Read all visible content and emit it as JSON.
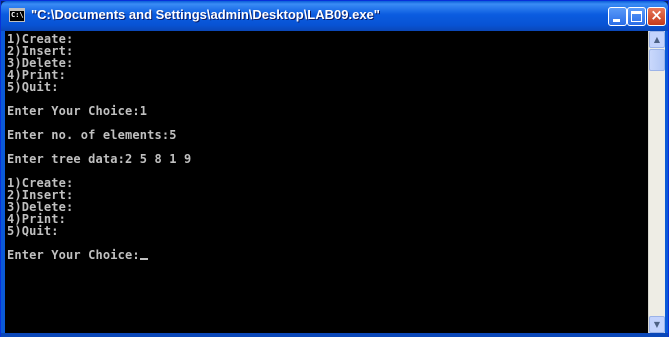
{
  "window": {
    "title": "\"C:\\Documents and Settings\\admin\\Desktop\\LAB09.exe\"",
    "icon_text": "C:\\",
    "accent_color": "#0a5fd8",
    "close_color": "#c43a1a"
  },
  "title_buttons": {
    "minimize_icon": "minimize-icon",
    "maximize_icon": "maximize-icon",
    "close_icon": "close-icon",
    "close_glyph": "×"
  },
  "console": {
    "background": "#000000",
    "foreground": "#c0c0c0",
    "lines": [
      "1)Create:",
      "2)Insert:",
      "3)Delete:",
      "4)Print:",
      "5)Quit:",
      "",
      "Enter Your Choice:1",
      "",
      "Enter no. of elements:5",
      "",
      "Enter tree data:2 5 8 1 9",
      "",
      "1)Create:",
      "2)Insert:",
      "3)Delete:",
      "4)Print:",
      "5)Quit:",
      "",
      "Enter Your Choice:"
    ]
  },
  "scrollbar": {
    "up_glyph": "▲",
    "down_glyph": "▼"
  }
}
